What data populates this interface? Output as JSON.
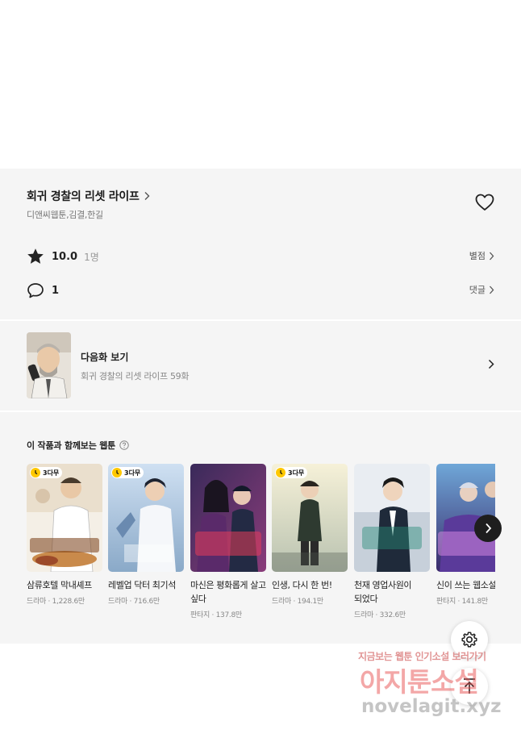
{
  "work": {
    "title": "회귀 경찰의 리셋 라이프",
    "authors": "디앤씨웹툰,김결,한길"
  },
  "rating": {
    "value": "10.0",
    "count": "1명",
    "link_label": "별점"
  },
  "comments": {
    "count": "1",
    "link_label": "댓글"
  },
  "next_episode": {
    "label": "다음화 보기",
    "subtitle": "회귀 경찰의 리셋 라이프 59화"
  },
  "recommendations": {
    "heading": "이 작품과 함께보는 웹툰",
    "items": [
      {
        "title": "삼류호텔 막내셰프",
        "meta": "드라마 · 1,228.6만",
        "badge": "3다무",
        "cover_text": "삼류 호텔 막내셰프"
      },
      {
        "title": "레벨업 닥터 최기석",
        "meta": "드라마 · 716.6만",
        "badge": "3다무",
        "cover_text": "레벨업 닥터 최기석"
      },
      {
        "title": "마신은 평화롭게 살고 싶다",
        "meta": "판타지 · 137.8만",
        "badge": "",
        "cover_text": "마신은 평화롭게 살고싶다"
      },
      {
        "title": "인생, 다시 한 번!",
        "meta": "드라마 · 194.1만",
        "badge": "3다무",
        "cover_text": "다시 한 번"
      },
      {
        "title": "천재 영업사원이 되었다",
        "meta": "드라마 · 332.6만",
        "badge": "",
        "cover_text": "천재 영업사원"
      },
      {
        "title": "신이 쓰는 웹소설",
        "meta": "판타지 · 141.8만",
        "badge": "",
        "cover_text": "신이 쓰는 웹소설"
      }
    ]
  },
  "watermark": {
    "line1": "지금보는 웹툰 인기소설 보러가기",
    "line2": "아지툰소설",
    "line3": "novelagit.xyz"
  },
  "colors": {
    "panel_bg": "#f5f5f5",
    "badge_yellow": "#ffc800",
    "text_main": "#222222",
    "text_muted": "#888888"
  },
  "icons": [
    "heart-icon",
    "star-icon",
    "comment-icon",
    "chevron-right-icon",
    "help-icon",
    "clock-icon",
    "settings-icon",
    "arrow-up-icon"
  ]
}
